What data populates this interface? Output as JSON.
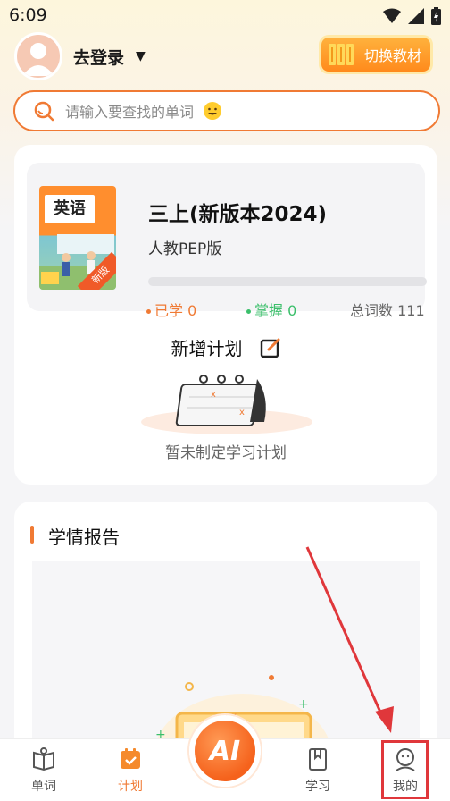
{
  "status_bar": {
    "time": "6:09"
  },
  "header": {
    "login_label": "去登录",
    "switch_label": "切换教材"
  },
  "search": {
    "placeholder": "请输入要查找的单词"
  },
  "book": {
    "cover_title": "英语",
    "cover_tag": "新版",
    "title": "三上(新版本2024)",
    "edition": "人教PEP版",
    "learned_label": "已学",
    "learned_value": "0",
    "mastered_label": "掌握",
    "mastered_value": "0",
    "total_label": "总词数",
    "total_value": "111",
    "progress": 0
  },
  "plan": {
    "title": "新增计划",
    "empty_text": "暂未制定学习计划"
  },
  "report": {
    "title": "学情报告"
  },
  "nav": {
    "items": [
      {
        "label": "单词",
        "icon": "book-open-icon"
      },
      {
        "label": "计划",
        "icon": "calendar-check-icon"
      },
      {
        "label": "AI",
        "icon": "ai-icon"
      },
      {
        "label": "学习",
        "icon": "bookmark-book-icon"
      },
      {
        "label": "我的",
        "icon": "user-face-icon"
      }
    ]
  },
  "colors": {
    "accent": "#f07a34",
    "mastered": "#3bbf6b",
    "highlight": "#e0373b"
  }
}
